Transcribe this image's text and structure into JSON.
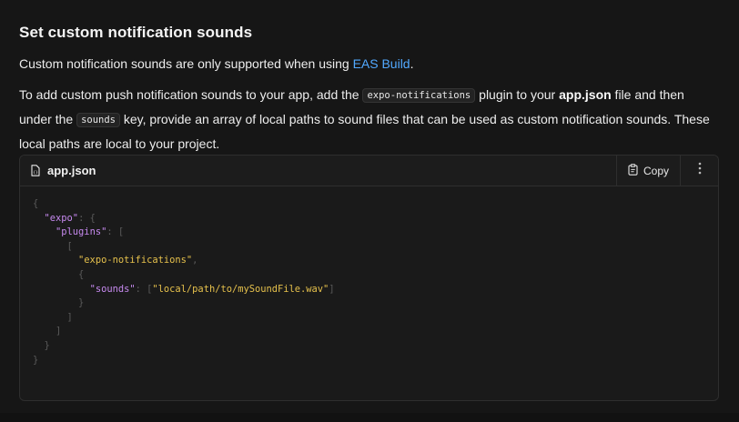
{
  "section": {
    "title": "Set custom notification sounds",
    "intro_text": "Custom notification sounds are only supported when using ",
    "intro_link": "EAS Build",
    "intro_end": ".",
    "para": {
      "t1": "To add custom push notification sounds to your app, add the ",
      "code1": "expo-notifications",
      "t2": " plugin to your ",
      "bold1": "app.json",
      "t3": " file and then under the ",
      "code2": "sounds",
      "t4": " key, provide an array of local paths to sound files that can be used as custom notification sounds. These local paths are local to your project."
    }
  },
  "code_block": {
    "filename": "app.json",
    "copy_label": "Copy",
    "lines": [
      {
        "indent": "",
        "parts": [
          {
            "t": "p",
            "v": "{"
          }
        ]
      },
      {
        "indent": "  ",
        "parts": [
          {
            "t": "k",
            "v": "\"expo\""
          },
          {
            "t": "p",
            "v": ": {"
          }
        ]
      },
      {
        "indent": "    ",
        "parts": [
          {
            "t": "k",
            "v": "\"plugins\""
          },
          {
            "t": "p",
            "v": ": ["
          }
        ]
      },
      {
        "indent": "      ",
        "parts": [
          {
            "t": "p",
            "v": "["
          }
        ]
      },
      {
        "indent": "        ",
        "parts": [
          {
            "t": "s",
            "v": "\"expo-notifications\""
          },
          {
            "t": "p",
            "v": ","
          }
        ]
      },
      {
        "indent": "        ",
        "parts": [
          {
            "t": "p",
            "v": "{"
          }
        ]
      },
      {
        "indent": "          ",
        "parts": [
          {
            "t": "k",
            "v": "\"sounds\""
          },
          {
            "t": "p",
            "v": ": ["
          },
          {
            "t": "s",
            "v": "\"local/path/to/mySoundFile.wav\""
          },
          {
            "t": "p",
            "v": "]"
          }
        ]
      },
      {
        "indent": "        ",
        "parts": [
          {
            "t": "p",
            "v": "}"
          }
        ]
      },
      {
        "indent": "      ",
        "parts": [
          {
            "t": "p",
            "v": "]"
          }
        ]
      },
      {
        "indent": "    ",
        "parts": [
          {
            "t": "p",
            "v": "]"
          }
        ]
      },
      {
        "indent": "  ",
        "parts": [
          {
            "t": "p",
            "v": "}"
          }
        ]
      },
      {
        "indent": "",
        "parts": [
          {
            "t": "p",
            "v": "}"
          }
        ]
      }
    ]
  },
  "icons": {
    "file": "json-file-icon",
    "copy": "clipboard-icon",
    "more": "more-vertical-icon"
  },
  "colors": {
    "link": "#52a9ff",
    "json_key": "#c78af0",
    "json_string": "#e6c14c",
    "punctuation": "#5a5a5a"
  }
}
